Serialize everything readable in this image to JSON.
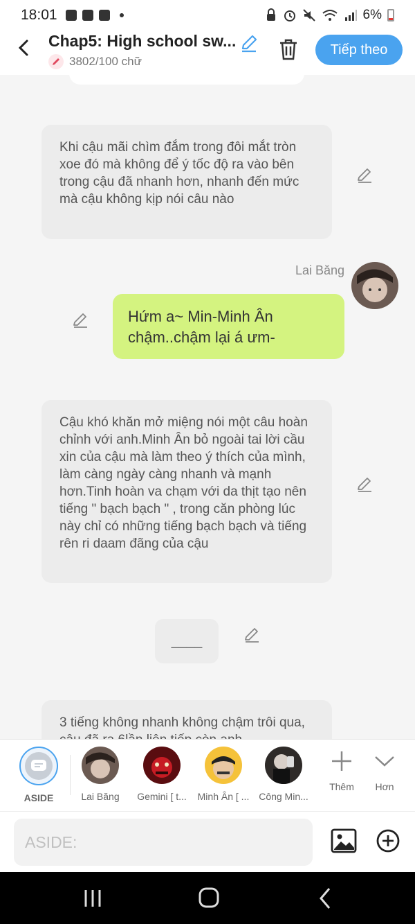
{
  "status": {
    "time": "18:01",
    "battery": "6%"
  },
  "header": {
    "title": "Chap5: High school sw...",
    "word_count": "3802/100 chữ",
    "next_label": "Tiếp theo"
  },
  "messages": {
    "narr1": "Khi cậu mãi chìm đắm trong đôi mắt tròn xoe đó mà không để ý tốc độ ra vào bên trong cậu đã nhanh hơn, nhanh đến mức mà cậu không kịp nói câu nào",
    "sender_name": "Lai Băng",
    "dialogue": "Hứm a~ Min-Minh Ân chậm..chậm lại á ưm-",
    "narr2": "Cậu khó khăn mở miệng nói một câu hoàn chỉnh với anh.Minh Ân bỏ ngoài tai lời cầu xin của cậu mà làm theo ý thích của mình, làm càng ngày càng nhanh và mạnh hơn.Tinh hoàn va chạm với da thịt tạo nên tiếng \" bạch bạch \" , trong căn phòng lúc này chỉ có những tiếng bạch bạch và tiếng rên ri daam đãng của cậu",
    "separator": "____",
    "narr3": "3 tiếng không nhanh không chậm trôi qua, cậu đã ra 6lần liên tiếp còn anh"
  },
  "characters": {
    "aside": "ASIDE",
    "c1": "Lai Băng",
    "c2": "Gemini [ t...",
    "c3": "Minh Ân [ ...",
    "c4": "Công Min...",
    "add": "Thêm",
    "more": "Hơn"
  },
  "input": {
    "placeholder": "ASIDE:"
  },
  "colors": {
    "accent": "#4aa3ef",
    "dialogue_bubble": "#d4f380",
    "narration_bubble": "#ececec"
  }
}
